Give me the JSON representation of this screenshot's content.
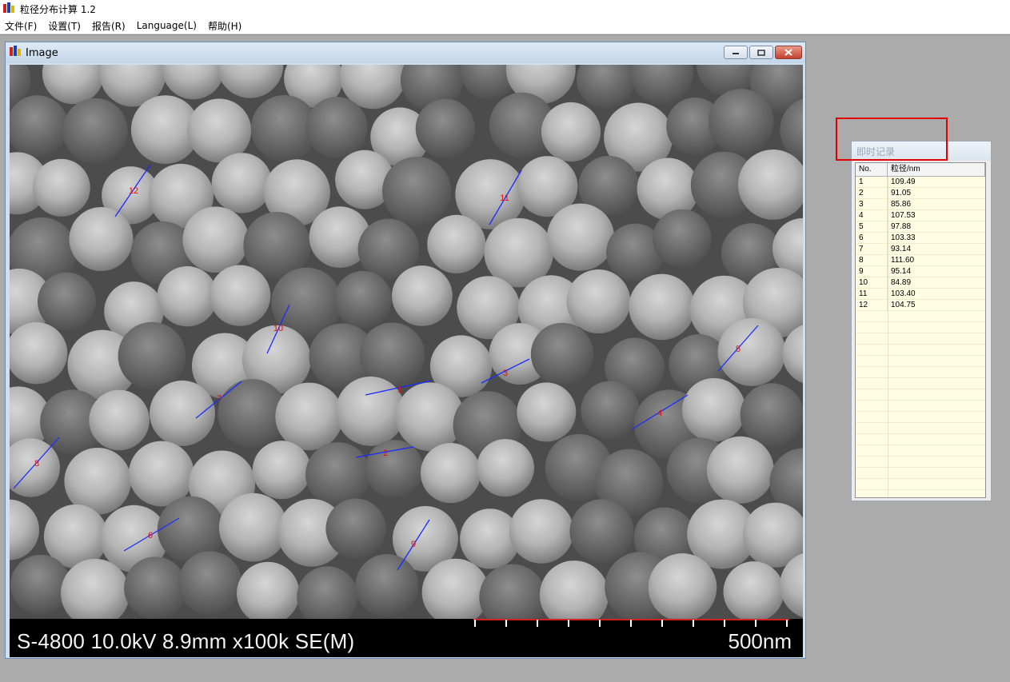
{
  "app": {
    "title": "粒径分布计算 1.2"
  },
  "menu": [
    {
      "label": "文件(F)"
    },
    {
      "label": "设置(T)"
    },
    {
      "label": "报告(R)"
    },
    {
      "label": "Language(L)"
    },
    {
      "label": "帮助(H)"
    }
  ],
  "image_window": {
    "title": "Image",
    "caption": "S-4800 10.0kV 8.9mm x100k SE(M)",
    "scale_label": "500nm"
  },
  "record_window": {
    "title": "即时记录",
    "columns": [
      "No.",
      "粒径/nm"
    ],
    "rows": [
      {
        "no": "1",
        "size": "109.49"
      },
      {
        "no": "2",
        "size": "91.05"
      },
      {
        "no": "3",
        "size": "85.86"
      },
      {
        "no": "4",
        "size": "107.53"
      },
      {
        "no": "5",
        "size": "97.88"
      },
      {
        "no": "6",
        "size": "103.33"
      },
      {
        "no": "7",
        "size": "93.14"
      },
      {
        "no": "8",
        "size": "111.60"
      },
      {
        "no": "9",
        "size": "95.14"
      },
      {
        "no": "10",
        "size": "84.89"
      },
      {
        "no": "11",
        "size": "103.40"
      },
      {
        "no": "12",
        "size": "104.75"
      }
    ]
  },
  "measurements": [
    {
      "label": "1"
    },
    {
      "label": "2"
    },
    {
      "label": "3"
    },
    {
      "label": "4"
    },
    {
      "label": "5"
    },
    {
      "label": "6"
    },
    {
      "label": "7"
    },
    {
      "label": "8"
    },
    {
      "label": "9"
    },
    {
      "label": "10"
    },
    {
      "label": "11"
    },
    {
      "label": "12"
    }
  ],
  "colors": {
    "measure_line": "#1a2cff",
    "measure_label": "#e01010",
    "highlight": "#e00000"
  }
}
